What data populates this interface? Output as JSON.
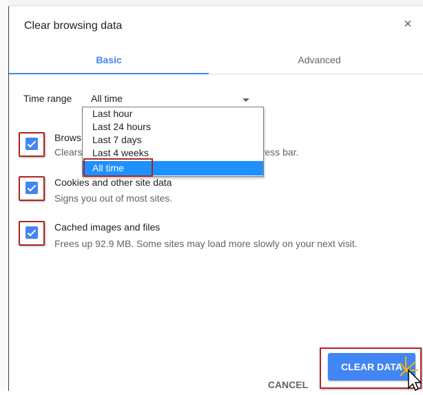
{
  "dialog": {
    "title": "Clear browsing data",
    "close_icon": "×"
  },
  "tabs": [
    {
      "label": "Basic",
      "active": true
    },
    {
      "label": "Advanced",
      "active": false
    }
  ],
  "time_range": {
    "label": "Time range",
    "selected": "All time",
    "options": [
      "Last hour",
      "Last 24 hours",
      "Last 7 days",
      "Last 4 weeks",
      "All time"
    ]
  },
  "items": [
    {
      "title": "Browsing history",
      "title_visible": "Brows",
      "description": "Clears history and autocompletions in the address bar.",
      "desc_visible_left": "Clears",
      "desc_visible_right": "dress bar.",
      "checked": true
    },
    {
      "title": "Cookies and other site data",
      "description": "Signs you out of most sites.",
      "checked": true
    },
    {
      "title": "Cached images and files",
      "description": "Frees up 92.9 MB. Some sites may load more slowly on your next visit.",
      "checked": true
    }
  ],
  "buttons": {
    "cancel": "CANCEL",
    "clear": "CLEAR DATA"
  },
  "colors": {
    "accent": "#4285f4",
    "highlight": "#b22222",
    "dropdown_selected": "#1e90ff"
  }
}
